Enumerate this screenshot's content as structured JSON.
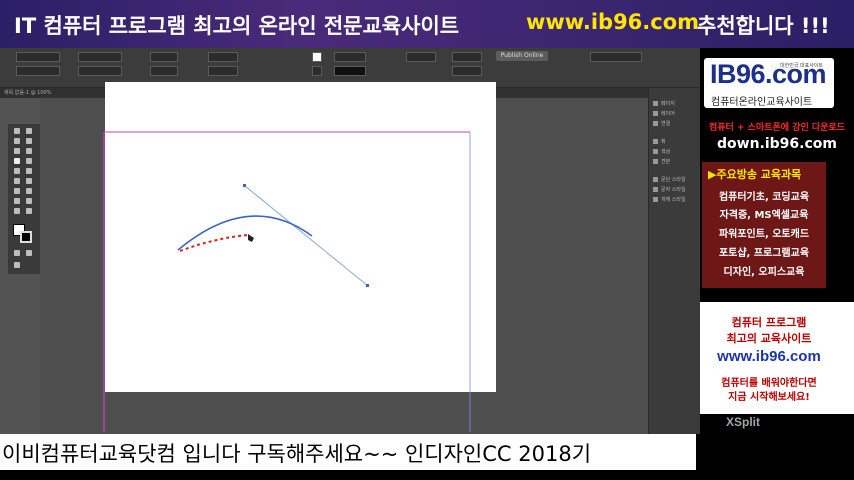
{
  "banner": {
    "title": "IT 컴퓨터 프로그램 최고의 온라인 전문교육사이트",
    "url": "www.ib96.com",
    "tagline": "추천합니다 !!!"
  },
  "indesign": {
    "document_button_label": "Publish Online",
    "tab_label": "제목 없음-1 @ 100%",
    "right_panel_items": [
      "페이지",
      "레이어",
      "연결",
      "획",
      "색상",
      "견본",
      "문단 스타일",
      "문자 스타일",
      "개체 스타일"
    ],
    "colors": {
      "curve": "#3a63c8",
      "pen_path": "#e02020",
      "handle_line": "#88aadd",
      "margin_guide": "#c542c5"
    }
  },
  "ad": {
    "logo_text": "IB96.com",
    "logo_tiny": "대한민국 대표사이트",
    "logo_sub": "컴퓨터온라인교육사이트",
    "promo_line": "컴퓨터 + 스마트폰에 강인 다운로드",
    "download_url": "down.ib96.com",
    "courses_heading": "▶주요방송 교육과목",
    "courses": [
      "컴퓨터기초, 코딩교육",
      "자격증, MS엑셀교육",
      "파워포인트, 오토캐드",
      "포토샵, 프로그램교육",
      "디자인, 오피스교육"
    ],
    "white_lines": [
      "컴퓨터 프로그램",
      "최고의 교육사이트",
      "www.ib96.com",
      "컴퓨터를 배워야한다면",
      "지금 시작해보세요!"
    ],
    "watermark": "XSplit"
  },
  "subtitle": "이비컴퓨터교육닷컴 입니다 구독해주세요~~ 인디자인CC 2018기"
}
